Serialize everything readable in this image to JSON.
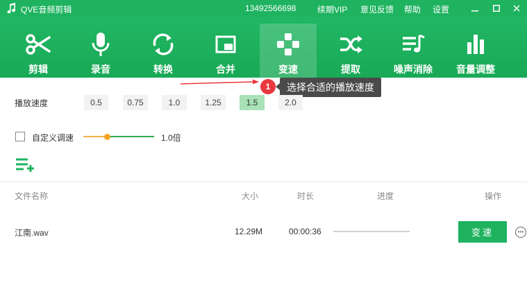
{
  "titlebar": {
    "app_title": "QVE音频剪辑",
    "phone": "13492566698",
    "menu": [
      "续期VIP",
      "意见反馈",
      "帮助",
      "设置"
    ],
    "window_buttons": [
      "minimize-icon",
      "maximize-icon",
      "close-icon"
    ]
  },
  "toolbar": {
    "tools": [
      {
        "label": "剪辑",
        "icon": "scissors-icon"
      },
      {
        "label": "录音",
        "icon": "microphone-icon"
      },
      {
        "label": "转换",
        "icon": "convert-icon"
      },
      {
        "label": "合并",
        "icon": "merge-icon"
      },
      {
        "label": "变速",
        "icon": "gamepad-icon"
      },
      {
        "label": "提取",
        "icon": "shuffle-icon"
      },
      {
        "label": "噪声消除",
        "icon": "playlist-icon"
      },
      {
        "label": "音量调整",
        "icon": "bar-chart-icon"
      }
    ],
    "active_index": 4
  },
  "callout": {
    "step": "1",
    "text": "选择合适的播放速度",
    "badge_color": "#e8383d"
  },
  "speed": {
    "label": "播放速度",
    "options": [
      "0.5",
      "0.75",
      "1.0",
      "1.25",
      "1.5",
      "2.0"
    ],
    "selected_index": 4
  },
  "custom_speed": {
    "checked": false,
    "label": "自定义调速",
    "slider_fraction": 0.34,
    "value": "1.0倍"
  },
  "add_files_icon": "add-list-icon",
  "table": {
    "headers": [
      "文件名称",
      "大小",
      "时长",
      "进度",
      "操作"
    ],
    "rows": [
      {
        "name": "江南.wav",
        "size": "12.29M",
        "duration": "00:00:36",
        "progress": 0,
        "action": "变速",
        "more_icon": "ellipsis-icon"
      }
    ]
  },
  "colors": {
    "brand": "#1fb360",
    "selected_option": "#a8e2b6",
    "tooltip": "#4a4a4a",
    "slider_thumb": "#f5a623"
  }
}
